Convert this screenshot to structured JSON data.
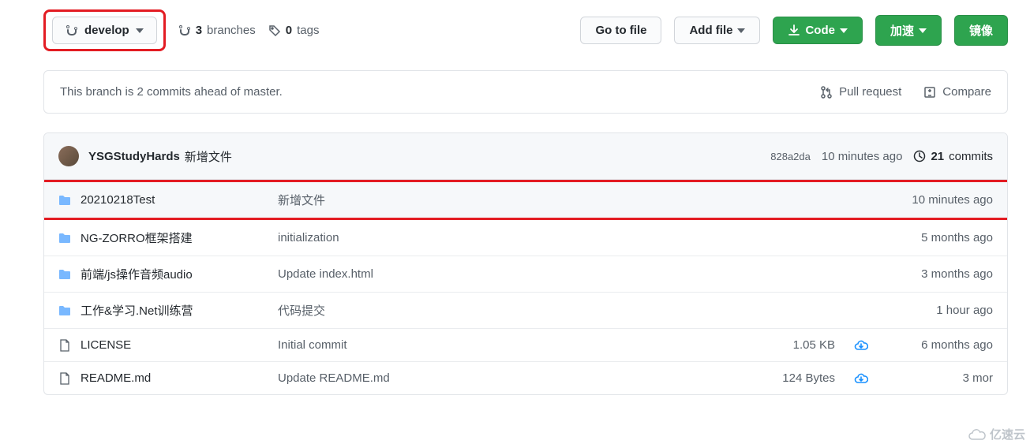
{
  "toolbar": {
    "branch_label": "develop",
    "branches_count": "3",
    "branches_label": "branches",
    "tags_count": "0",
    "tags_label": "tags",
    "go_to_file": "Go to file",
    "add_file": "Add file",
    "code": "Code",
    "accelerate": "加速",
    "mirror": "镜像"
  },
  "notice": {
    "text": "This branch is 2 commits ahead of master.",
    "pull_request": "Pull request",
    "compare": "Compare"
  },
  "header": {
    "author": "YSGStudyHards",
    "message": "新增文件",
    "sha": "828a2da",
    "ago": "10 minutes ago",
    "commits_count": "21",
    "commits_label": "commits"
  },
  "rows": [
    {
      "type": "dir",
      "name": "20210218Test",
      "msg": "新增文件",
      "size": "",
      "cloud": false,
      "time": "10 minutes ago"
    },
    {
      "type": "dir",
      "name": "NG-ZORRO框架搭建",
      "msg": "initialization",
      "size": "",
      "cloud": false,
      "time": "5 months ago"
    },
    {
      "type": "dir",
      "name": "前端/js操作音频audio",
      "msg": "Update index.html",
      "size": "",
      "cloud": false,
      "time": "3 months ago"
    },
    {
      "type": "dir",
      "name": "工作&学习.Net训练营",
      "msg": "代码提交",
      "size": "",
      "cloud": false,
      "time": "1 hour ago"
    },
    {
      "type": "file",
      "name": "LICENSE",
      "msg": "Initial commit",
      "size": "1.05 KB",
      "cloud": true,
      "time": "6 months ago"
    },
    {
      "type": "file",
      "name": "README.md",
      "msg": "Update README.md",
      "size": "124 Bytes",
      "cloud": true,
      "time": "3 mor"
    }
  ],
  "watermark": "亿速云"
}
